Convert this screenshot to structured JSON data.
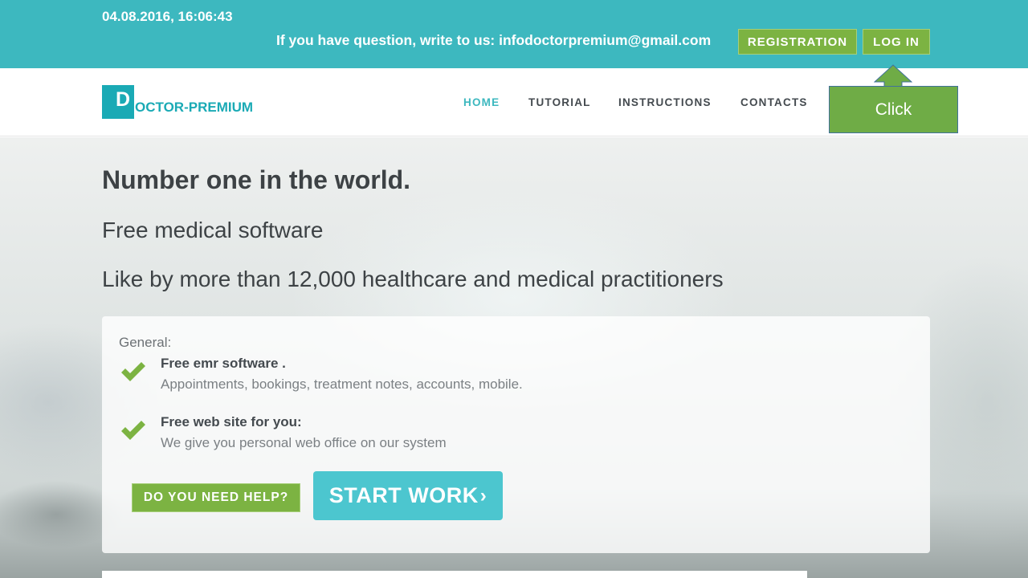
{
  "topbar": {
    "datetime": "04.08.2016, 16:06:43",
    "contact_text": "If you have question, write to us: infodoctorpremium@gmail.com",
    "registration_label": "REGISTRATION",
    "login_label": "LOG IN"
  },
  "logo": {
    "initial": "D",
    "text": "OCTOR-PREMIUM"
  },
  "nav": {
    "items": [
      {
        "label": "HOME",
        "active": true
      },
      {
        "label": "TUTORIAL",
        "active": false
      },
      {
        "label": "INSTRUCTIONS",
        "active": false
      },
      {
        "label": "CONTACTS",
        "active": false
      }
    ]
  },
  "callout": {
    "label": "Click"
  },
  "hero": {
    "title": "Number one in the world.",
    "subtitle1": "Free medical software",
    "subtitle2": "Like by more than 12,000 healthcare and medical practitioners"
  },
  "panel": {
    "label": "General:",
    "features": [
      {
        "title": "Free emr software .",
        "desc": "Appointments, bookings, treatment notes, accounts, mobile."
      },
      {
        "title": "Free web site for you:",
        "desc": "We give you personal web office on our system"
      }
    ],
    "help_label": "DO YOU NEED HELP?",
    "start_label": "START WORK",
    "start_chevron": "›"
  },
  "colors": {
    "teal": "#3db8bf",
    "green": "#7cb342",
    "callout_green": "#6fac46",
    "start_button": "#4cc6cf",
    "text_dark": "#3d4245"
  },
  "icons": [
    "check-icon",
    "chevron-right-icon",
    "arrow-up-icon"
  ]
}
